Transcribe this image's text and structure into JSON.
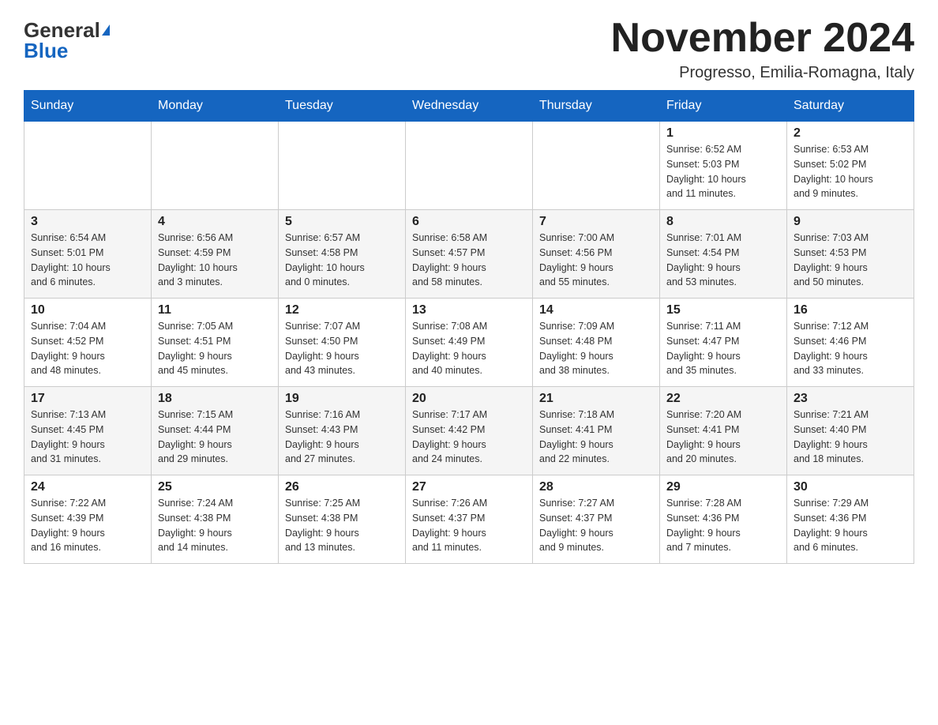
{
  "logo": {
    "general": "General",
    "blue": "Blue"
  },
  "title": "November 2024",
  "location": "Progresso, Emilia-Romagna, Italy",
  "weekdays": [
    "Sunday",
    "Monday",
    "Tuesday",
    "Wednesday",
    "Thursday",
    "Friday",
    "Saturday"
  ],
  "weeks": [
    [
      {
        "day": "",
        "info": ""
      },
      {
        "day": "",
        "info": ""
      },
      {
        "day": "",
        "info": ""
      },
      {
        "day": "",
        "info": ""
      },
      {
        "day": "",
        "info": ""
      },
      {
        "day": "1",
        "info": "Sunrise: 6:52 AM\nSunset: 5:03 PM\nDaylight: 10 hours\nand 11 minutes."
      },
      {
        "day": "2",
        "info": "Sunrise: 6:53 AM\nSunset: 5:02 PM\nDaylight: 10 hours\nand 9 minutes."
      }
    ],
    [
      {
        "day": "3",
        "info": "Sunrise: 6:54 AM\nSunset: 5:01 PM\nDaylight: 10 hours\nand 6 minutes."
      },
      {
        "day": "4",
        "info": "Sunrise: 6:56 AM\nSunset: 4:59 PM\nDaylight: 10 hours\nand 3 minutes."
      },
      {
        "day": "5",
        "info": "Sunrise: 6:57 AM\nSunset: 4:58 PM\nDaylight: 10 hours\nand 0 minutes."
      },
      {
        "day": "6",
        "info": "Sunrise: 6:58 AM\nSunset: 4:57 PM\nDaylight: 9 hours\nand 58 minutes."
      },
      {
        "day": "7",
        "info": "Sunrise: 7:00 AM\nSunset: 4:56 PM\nDaylight: 9 hours\nand 55 minutes."
      },
      {
        "day": "8",
        "info": "Sunrise: 7:01 AM\nSunset: 4:54 PM\nDaylight: 9 hours\nand 53 minutes."
      },
      {
        "day": "9",
        "info": "Sunrise: 7:03 AM\nSunset: 4:53 PM\nDaylight: 9 hours\nand 50 minutes."
      }
    ],
    [
      {
        "day": "10",
        "info": "Sunrise: 7:04 AM\nSunset: 4:52 PM\nDaylight: 9 hours\nand 48 minutes."
      },
      {
        "day": "11",
        "info": "Sunrise: 7:05 AM\nSunset: 4:51 PM\nDaylight: 9 hours\nand 45 minutes."
      },
      {
        "day": "12",
        "info": "Sunrise: 7:07 AM\nSunset: 4:50 PM\nDaylight: 9 hours\nand 43 minutes."
      },
      {
        "day": "13",
        "info": "Sunrise: 7:08 AM\nSunset: 4:49 PM\nDaylight: 9 hours\nand 40 minutes."
      },
      {
        "day": "14",
        "info": "Sunrise: 7:09 AM\nSunset: 4:48 PM\nDaylight: 9 hours\nand 38 minutes."
      },
      {
        "day": "15",
        "info": "Sunrise: 7:11 AM\nSunset: 4:47 PM\nDaylight: 9 hours\nand 35 minutes."
      },
      {
        "day": "16",
        "info": "Sunrise: 7:12 AM\nSunset: 4:46 PM\nDaylight: 9 hours\nand 33 minutes."
      }
    ],
    [
      {
        "day": "17",
        "info": "Sunrise: 7:13 AM\nSunset: 4:45 PM\nDaylight: 9 hours\nand 31 minutes."
      },
      {
        "day": "18",
        "info": "Sunrise: 7:15 AM\nSunset: 4:44 PM\nDaylight: 9 hours\nand 29 minutes."
      },
      {
        "day": "19",
        "info": "Sunrise: 7:16 AM\nSunset: 4:43 PM\nDaylight: 9 hours\nand 27 minutes."
      },
      {
        "day": "20",
        "info": "Sunrise: 7:17 AM\nSunset: 4:42 PM\nDaylight: 9 hours\nand 24 minutes."
      },
      {
        "day": "21",
        "info": "Sunrise: 7:18 AM\nSunset: 4:41 PM\nDaylight: 9 hours\nand 22 minutes."
      },
      {
        "day": "22",
        "info": "Sunrise: 7:20 AM\nSunset: 4:41 PM\nDaylight: 9 hours\nand 20 minutes."
      },
      {
        "day": "23",
        "info": "Sunrise: 7:21 AM\nSunset: 4:40 PM\nDaylight: 9 hours\nand 18 minutes."
      }
    ],
    [
      {
        "day": "24",
        "info": "Sunrise: 7:22 AM\nSunset: 4:39 PM\nDaylight: 9 hours\nand 16 minutes."
      },
      {
        "day": "25",
        "info": "Sunrise: 7:24 AM\nSunset: 4:38 PM\nDaylight: 9 hours\nand 14 minutes."
      },
      {
        "day": "26",
        "info": "Sunrise: 7:25 AM\nSunset: 4:38 PM\nDaylight: 9 hours\nand 13 minutes."
      },
      {
        "day": "27",
        "info": "Sunrise: 7:26 AM\nSunset: 4:37 PM\nDaylight: 9 hours\nand 11 minutes."
      },
      {
        "day": "28",
        "info": "Sunrise: 7:27 AM\nSunset: 4:37 PM\nDaylight: 9 hours\nand 9 minutes."
      },
      {
        "day": "29",
        "info": "Sunrise: 7:28 AM\nSunset: 4:36 PM\nDaylight: 9 hours\nand 7 minutes."
      },
      {
        "day": "30",
        "info": "Sunrise: 7:29 AM\nSunset: 4:36 PM\nDaylight: 9 hours\nand 6 minutes."
      }
    ]
  ]
}
